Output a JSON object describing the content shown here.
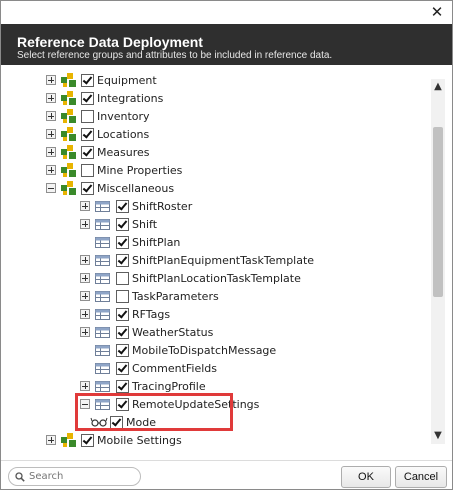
{
  "dialog": {
    "title": "Reference Data Deployment",
    "subtitle": "Select reference groups and attributes to be included in reference data.",
    "close_glyph": "✕"
  },
  "tree": {
    "items": [
      {
        "label": "Equipment",
        "level": 0,
        "type": "group",
        "expander": "plus",
        "checked": true
      },
      {
        "label": "Integrations",
        "level": 0,
        "type": "group",
        "expander": "plus",
        "checked": true
      },
      {
        "label": "Inventory",
        "level": 0,
        "type": "group",
        "expander": "plus",
        "checked": false
      },
      {
        "label": "Locations",
        "level": 0,
        "type": "group",
        "expander": "plus",
        "checked": true
      },
      {
        "label": "Measures",
        "level": 0,
        "type": "group",
        "expander": "plus",
        "checked": true
      },
      {
        "label": "Mine Properties",
        "level": 0,
        "type": "group",
        "expander": "plus",
        "checked": false
      },
      {
        "label": "Miscellaneous",
        "level": 0,
        "type": "group",
        "expander": "minus",
        "checked": true
      },
      {
        "label": "ShiftRoster",
        "level": 1,
        "type": "table",
        "expander": "plus",
        "checked": true
      },
      {
        "label": "Shift",
        "level": 1,
        "type": "table",
        "expander": "plus",
        "checked": true
      },
      {
        "label": "ShiftPlan",
        "level": 1,
        "type": "table",
        "expander": "none",
        "checked": true
      },
      {
        "label": "ShiftPlanEquipmentTaskTemplate",
        "level": 1,
        "type": "table",
        "expander": "plus",
        "checked": true
      },
      {
        "label": "ShiftPlanLocationTaskTemplate",
        "level": 1,
        "type": "table",
        "expander": "plus",
        "checked": false
      },
      {
        "label": "TaskParameters",
        "level": 1,
        "type": "table",
        "expander": "plus",
        "checked": false
      },
      {
        "label": "RFTags",
        "level": 1,
        "type": "table",
        "expander": "plus",
        "checked": true
      },
      {
        "label": "WeatherStatus",
        "level": 1,
        "type": "table",
        "expander": "plus",
        "checked": true
      },
      {
        "label": "MobileToDispatchMessage",
        "level": 1,
        "type": "table",
        "expander": "none",
        "checked": true
      },
      {
        "label": "CommentFields",
        "level": 1,
        "type": "table",
        "expander": "none",
        "checked": true
      },
      {
        "label": "TracingProfile",
        "level": 1,
        "type": "table",
        "expander": "plus",
        "checked": true
      },
      {
        "label": "RemoteUpdateSettings",
        "level": 1,
        "type": "table",
        "expander": "minus",
        "checked": true
      },
      {
        "label": "Mode",
        "level": 2,
        "type": "attribute",
        "expander": "none",
        "checked": true
      },
      {
        "label": "Mobile Settings",
        "level": 0,
        "type": "group",
        "expander": "plus",
        "checked": true
      }
    ]
  },
  "search": {
    "placeholder": "Search",
    "value": ""
  },
  "buttons": {
    "ok": "OK",
    "cancel": "Cancel"
  },
  "colors": {
    "header_bg": "#2f2f2f",
    "highlight": "#e03a3a",
    "accent_green": "#3a8a2a",
    "accent_yellow": "#e8b400"
  }
}
